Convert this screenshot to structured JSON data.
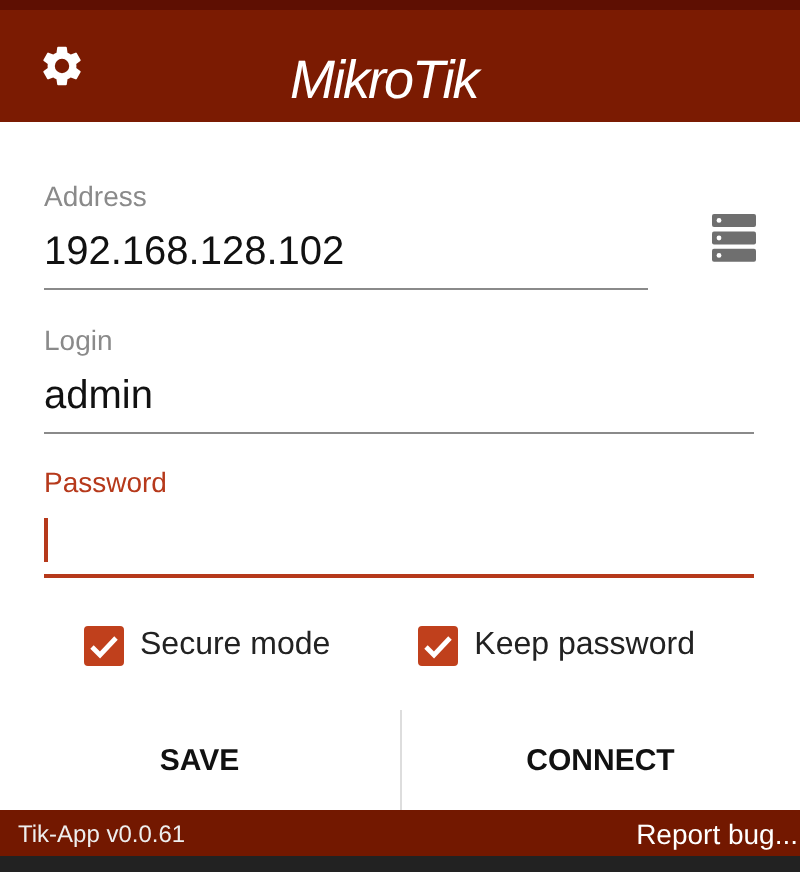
{
  "header": {
    "logo": "Mikro**Tik**"
  },
  "fields": [
    {
      "label": "Address",
      "value": "192.168.128.102",
      "focused": false,
      "kind": "address"
    },
    {
      "label": "Login",
      "value": "admin",
      "focused": false,
      "kind": "text"
    },
    {
      "label": "Password",
      "focused": true,
      "kind": "password"
    }
  ],
  "checkboxes": [
    {
      "label": "Secure mode",
      "checked": true
    },
    {
      "label": "Keep password",
      "checked": true
    }
  ],
  "buttons": [
    "SAVE",
    "CONNECT"
  ],
  "footer": {
    "version": "Tik-App v0.0.61",
    "link": "Report bug..."
  }
}
